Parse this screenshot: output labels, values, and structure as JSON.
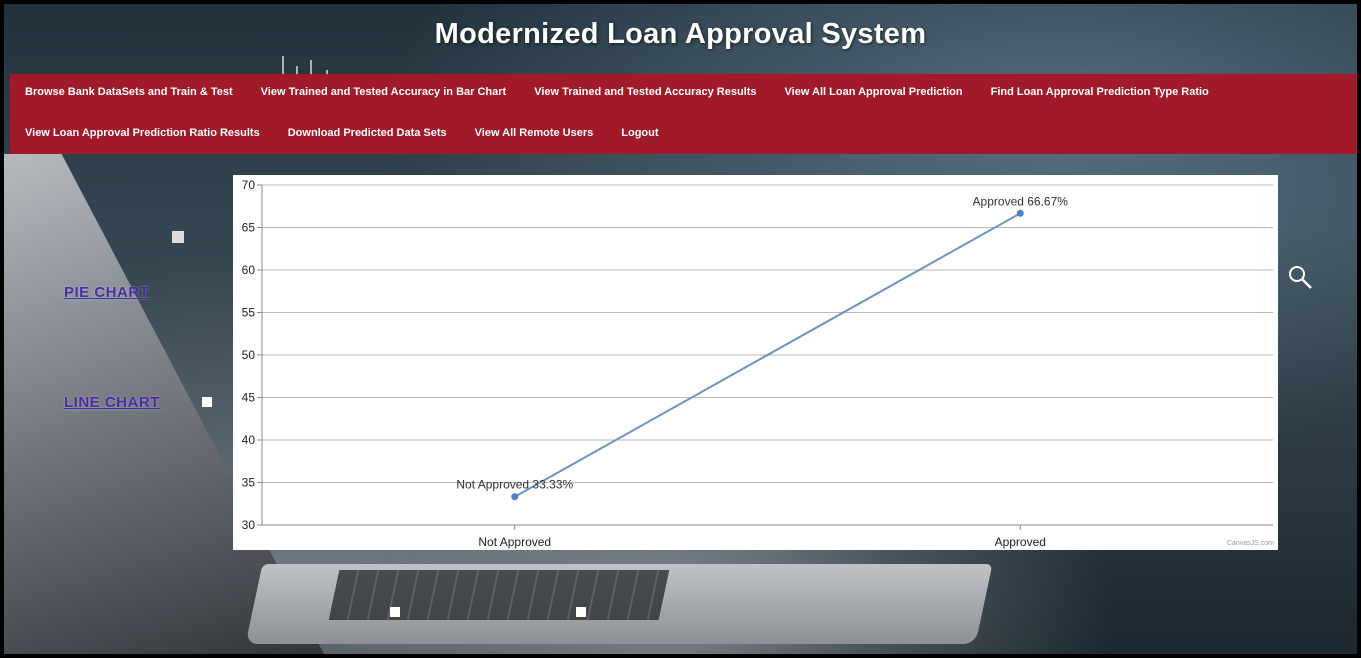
{
  "header": {
    "title": "Modernized Loan Approval System"
  },
  "nav": {
    "row1": [
      "Browse Bank DataSets and Train & Test",
      "View Trained and Tested Accuracy in Bar Chart",
      "View Trained and Tested Accuracy Results",
      "View All Loan Approval Prediction",
      "Find Loan Approval Prediction Type Ratio"
    ],
    "row2": [
      "View Loan Approval Prediction Ratio Results",
      "Download Predicted Data Sets",
      "View All Remote Users",
      "Logout"
    ]
  },
  "side_links": {
    "pie_chart": "PIE CHART",
    "line_chart": "LINE CHART"
  },
  "watermark": "CanvasJS.com",
  "colors": {
    "nav_bg": "#a01a2a",
    "line": "#6f93c6",
    "marker": "#4f81bd",
    "side_link": "#4b2aa8"
  },
  "chart_data": {
    "type": "line",
    "categories": [
      "Not Approved",
      "Approved"
    ],
    "values": [
      33.33,
      66.67
    ],
    "data_labels": [
      "Not Approved 33.33%",
      "Approved 66.67%"
    ],
    "ylim": [
      30,
      70
    ],
    "yticks": [
      "30",
      "35",
      "40",
      "45",
      "50",
      "55",
      "60",
      "65",
      "70"
    ],
    "grid": true,
    "title": "",
    "xlabel": "",
    "ylabel": ""
  }
}
